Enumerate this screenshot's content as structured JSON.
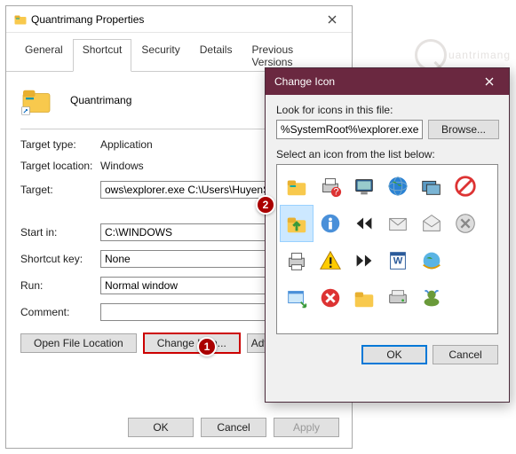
{
  "properties": {
    "title": "Quantrimang Properties",
    "tabs": [
      "General",
      "Shortcut",
      "Security",
      "Details",
      "Previous Versions"
    ],
    "active_tab": "Shortcut",
    "name": "Quantrimang",
    "fields": {
      "target_type_label": "Target type:",
      "target_type_value": "Application",
      "target_location_label": "Target location:",
      "target_location_value": "Windows",
      "target_label": "Target:",
      "target_value": "ows\\explorer.exe C:\\Users\\HuyenSP\\",
      "start_in_label": "Start in:",
      "start_in_value": "C:\\WINDOWS",
      "shortcut_key_label": "Shortcut key:",
      "shortcut_key_value": "None",
      "run_label": "Run:",
      "run_value": "Normal window",
      "comment_label": "Comment:",
      "comment_value": ""
    },
    "buttons": {
      "open_file_location": "Open File Location",
      "change_icon": "Change Icon...",
      "advanced": "Adv",
      "ok": "OK",
      "cancel": "Cancel",
      "apply": "Apply"
    }
  },
  "change_icon": {
    "title": "Change Icon",
    "look_label": "Look for icons in this file:",
    "path_value": "%SystemRoot%\\explorer.exe",
    "browse": "Browse...",
    "select_label": "Select an icon from the list below:",
    "ok": "OK",
    "cancel": "Cancel",
    "icons": [
      "folder-icon",
      "printer-help-icon",
      "monitor-icon",
      "globe-icon",
      "windows-stack-icon",
      "blocked-icon",
      "folder-up-icon",
      "info-icon",
      "rewind-icon",
      "envelope-icon",
      "envelope-open-icon",
      "cross-grey-icon",
      "printer-icon",
      "warning-icon",
      "fast-forward-icon",
      "word-doc-icon",
      "globe-net-icon",
      "blank-icon",
      "window-arrow-icon",
      "error-icon",
      "folder-plain-icon",
      "drive-icon",
      "msn-icon",
      "blank-icon"
    ],
    "selected_index": 6
  },
  "badges": {
    "one": "1",
    "two": "2"
  },
  "watermark": "uantrimang"
}
